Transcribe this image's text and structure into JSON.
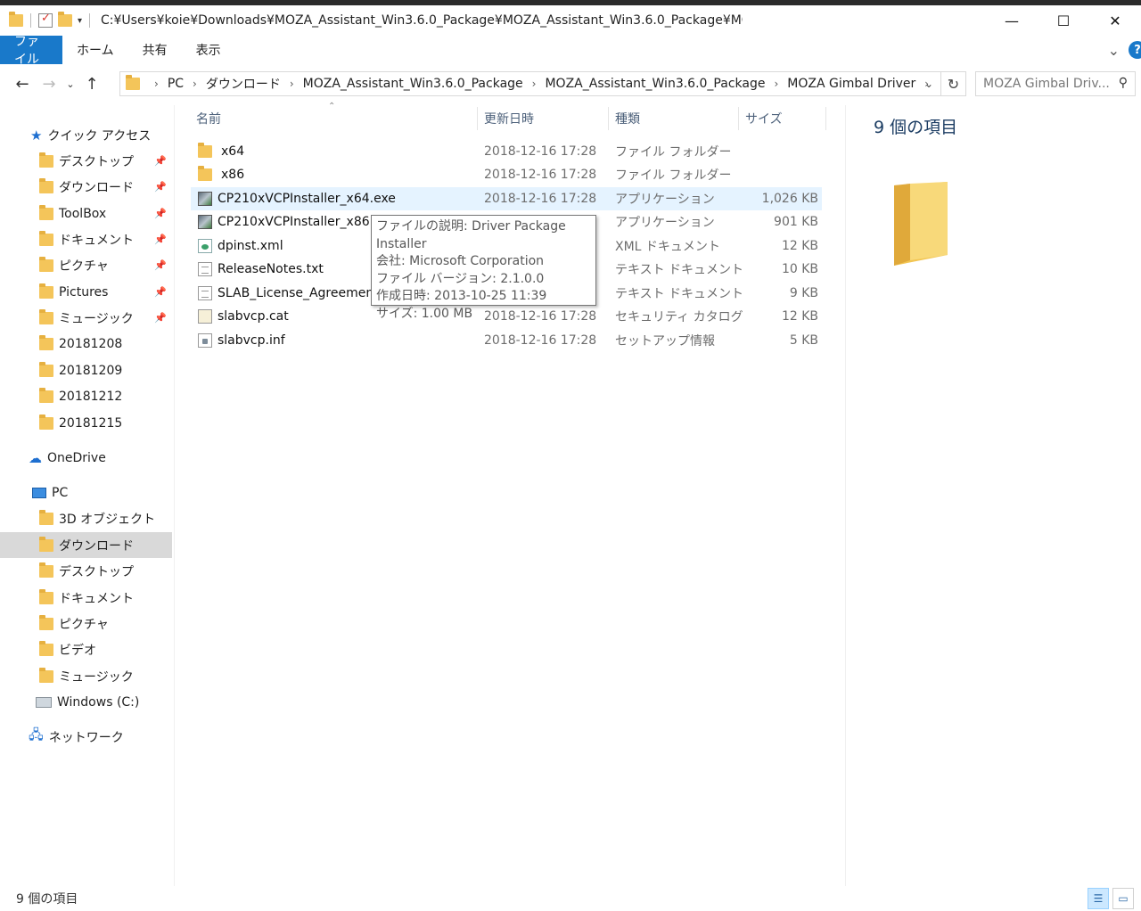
{
  "window": {
    "title": "C:¥Users¥koie¥Downloads¥MOZA_Assistant_Win3.6.0_Package¥MOZA_Assistant_Win3.6.0_Package¥MOZA Gi",
    "minimize": "—",
    "maximize": "☐",
    "close": "✕"
  },
  "ribbon": {
    "tabs": [
      "ファイル",
      "ホーム",
      "共有",
      "表示"
    ],
    "expand": "⌄",
    "help": "?"
  },
  "address": {
    "crumbs": [
      "PC",
      "ダウンロード",
      "MOZA_Assistant_Win3.6.0_Package",
      "MOZA_Assistant_Win3.6.0_Package",
      "MOZA Gimbal Driver"
    ],
    "search_placeholder": "MOZA Gimbal Driv..."
  },
  "nav": {
    "quick_access": "クイック アクセス",
    "quick_items": [
      {
        "label": "デスクトップ",
        "pinned": true
      },
      {
        "label": "ダウンロード",
        "pinned": true
      },
      {
        "label": "ToolBox",
        "pinned": true
      },
      {
        "label": "ドキュメント",
        "pinned": true
      },
      {
        "label": "ピクチャ",
        "pinned": true
      },
      {
        "label": "Pictures",
        "pinned": true
      },
      {
        "label": "ミュージック",
        "pinned": true
      },
      {
        "label": "20181208",
        "pinned": false
      },
      {
        "label": "20181209",
        "pinned": false
      },
      {
        "label": "20181212",
        "pinned": false
      },
      {
        "label": "20181215",
        "pinned": false
      }
    ],
    "onedrive": "OneDrive",
    "pc": "PC",
    "pc_items": [
      "3D オブジェクト",
      "ダウンロード",
      "デスクトップ",
      "ドキュメント",
      "ピクチャ",
      "ビデオ",
      "ミュージック",
      "Windows (C:)"
    ],
    "network": "ネットワーク"
  },
  "columns": {
    "name": "名前",
    "date": "更新日時",
    "type": "種類",
    "size": "サイズ"
  },
  "files": [
    {
      "name": "x64",
      "date": "2018-12-16 17:28",
      "type": "ファイル フォルダー",
      "size": "",
      "icon": "folder-icon"
    },
    {
      "name": "x86",
      "date": "2018-12-16 17:28",
      "type": "ファイル フォルダー",
      "size": "",
      "icon": "folder-icon"
    },
    {
      "name": "CP210xVCPInstaller_x64.exe",
      "date": "2018-12-16 17:28",
      "type": "アプリケーション",
      "size": "1,026 KB",
      "icon": "exe-icon"
    },
    {
      "name": "CP210xVCPInstaller_x86.exe",
      "date": "",
      "type": "アプリケーション",
      "size": "901 KB",
      "icon": "exe-icon"
    },
    {
      "name": "dpinst.xml",
      "date": "",
      "type": "XML ドキュメント",
      "size": "12 KB",
      "icon": "xml-icon"
    },
    {
      "name": "ReleaseNotes.txt",
      "date": "",
      "type": "テキスト ドキュメント",
      "size": "10 KB",
      "icon": "text-icon"
    },
    {
      "name": "SLAB_License_Agreement_",
      "date": "",
      "type": "テキスト ドキュメント",
      "size": "9 KB",
      "icon": "text-icon"
    },
    {
      "name": "slabvcp.cat",
      "date": "2018-12-16 17:28",
      "type": "セキュリティ カタログ",
      "size": "12 KB",
      "icon": "catalog-icon"
    },
    {
      "name": "slabvcp.inf",
      "date": "2018-12-16 17:28",
      "type": "セットアップ情報",
      "size": "5 KB",
      "icon": "setup-info-icon"
    }
  ],
  "tooltip": {
    "lines": [
      "ファイルの説明: Driver Package Installer",
      "会社: Microsoft Corporation",
      "ファイル バージョン: 2.1.0.0",
      "作成日時: 2013-10-25 11:39",
      "サイズ: 1.00 MB"
    ]
  },
  "details": {
    "count": "9 個の項目"
  },
  "status": {
    "count": "9 個の項目"
  },
  "colors": {
    "accent": "#1979ca",
    "selection": "#e5f3ff",
    "nav_selected": "#d9d9d9",
    "folder": "#f4c55a"
  }
}
